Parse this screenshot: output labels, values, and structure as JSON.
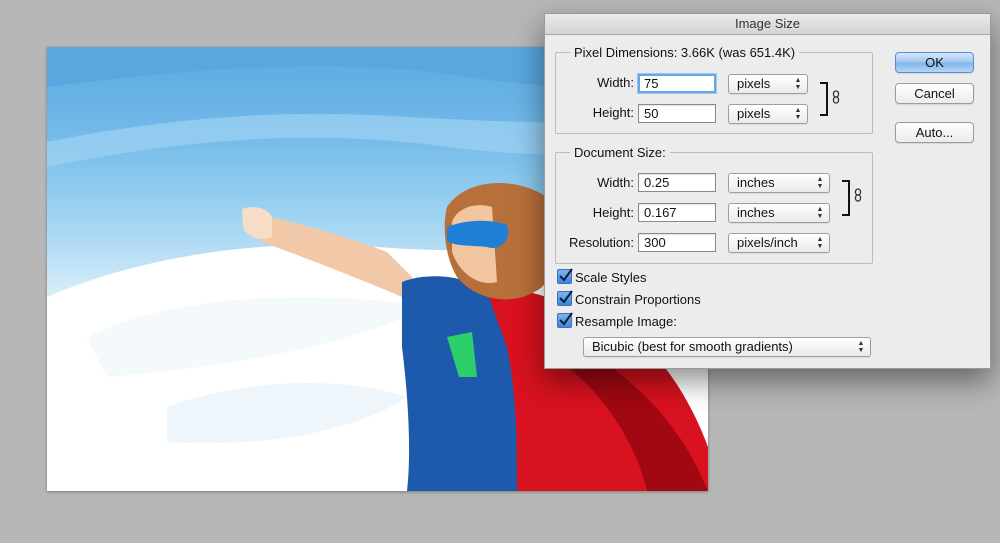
{
  "dialog": {
    "title": "Image Size",
    "pixel_dimensions": {
      "legend": "Pixel Dimensions:  3.66K (was 651.4K)",
      "width": {
        "label": "Width:",
        "value": "75",
        "unit": "pixels"
      },
      "height": {
        "label": "Height:",
        "value": "50",
        "unit": "pixels"
      }
    },
    "document_size": {
      "legend": "Document Size:",
      "width": {
        "label": "Width:",
        "value": "0.25",
        "unit": "inches"
      },
      "height": {
        "label": "Height:",
        "value": "0.167",
        "unit": "inches"
      },
      "resolution": {
        "label": "Resolution:",
        "value": "300",
        "unit": "pixels/inch"
      }
    },
    "options": {
      "scale_styles": {
        "label": "Scale Styles",
        "checked": true
      },
      "constrain_proportions": {
        "label": "Constrain Proportions",
        "checked": true
      },
      "resample_image": {
        "label": "Resample Image:",
        "checked": true
      },
      "resample_method": "Bicubic (best for smooth gradients)"
    },
    "buttons": {
      "ok": "OK",
      "cancel": "Cancel",
      "auto": "Auto..."
    }
  },
  "icons": {
    "link": "chain-link-icon",
    "select_arrows": "up-down-arrows-icon",
    "check": "checkmark-icon"
  },
  "colors": {
    "accent": "#6aa5e6",
    "default_button": "#7eb3ec",
    "checkbox": "#3d86dd"
  }
}
